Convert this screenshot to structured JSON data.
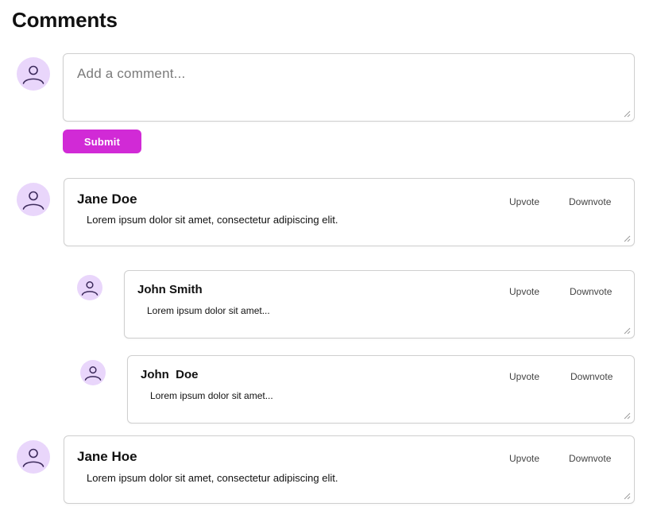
{
  "header": {
    "title": "Comments"
  },
  "composer": {
    "placeholder": "Add a comment...",
    "submit_label": "Submit"
  },
  "comments": [
    {
      "author": "Jane Doe",
      "text": "Lorem ipsum dolor sit amet, consectetur adipiscing elit.",
      "upvote_label": "Upvote",
      "downvote_label": "Downvote",
      "replies": [
        {
          "author": "John Smith",
          "text": "Lorem ipsum dolor sit amet...",
          "upvote_label": "Upvote",
          "downvote_label": "Downvote"
        },
        {
          "author": "John  Doe",
          "text": "Lorem ipsum dolor sit amet...",
          "upvote_label": "Upvote",
          "downvote_label": "Downvote"
        }
      ]
    },
    {
      "author": "Jane Hoe",
      "text": "Lorem ipsum dolor sit amet, consectetur adipiscing elit.",
      "upvote_label": "Upvote",
      "downvote_label": "Downvote",
      "replies": []
    }
  ],
  "colors": {
    "accent": "#d12ad6",
    "avatar_bg": "#e9d6fb",
    "avatar_icon": "#3d2b5c",
    "border": "#cfcfcf"
  },
  "icons": {
    "avatar": "user-icon",
    "resize": "resize-grip-icon"
  }
}
